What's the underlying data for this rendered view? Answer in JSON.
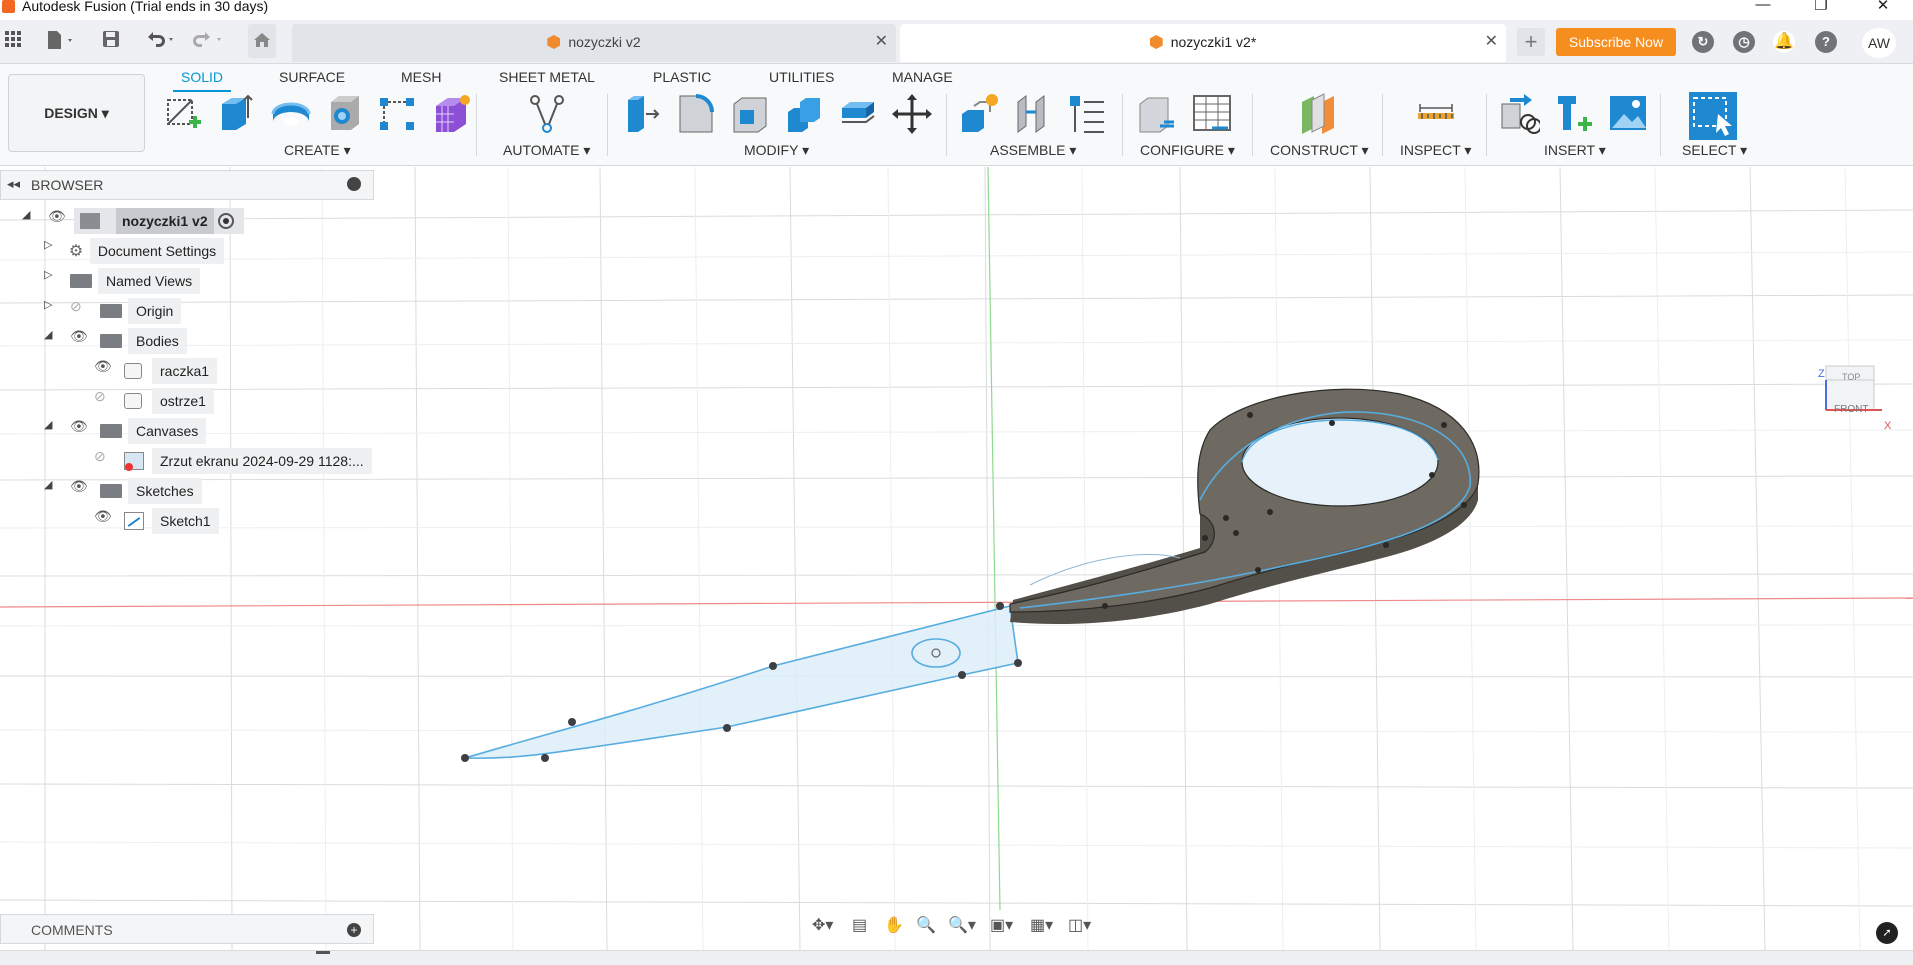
{
  "window": {
    "title": "Autodesk Fusion (Trial ends in 30 days)",
    "minimize": "—",
    "maximize": "❐",
    "close": "✕"
  },
  "quickbar": {
    "apps_icon": "grid-icon",
    "file_icon": "file-icon",
    "save_icon": "save-icon",
    "undo_icon": "undo-icon",
    "redo_icon": "redo-icon",
    "home_icon": "home-icon"
  },
  "tabs": [
    {
      "label": "nozyczki v2",
      "active": false
    },
    {
      "label": "nozyczki1 v2*",
      "active": true
    }
  ],
  "new_tab": "+",
  "subscribe": "Subscribe Now",
  "user_initials": "AW",
  "ribbon": {
    "workspace": "DESIGN ▾",
    "tabs": [
      "SOLID",
      "SURFACE",
      "MESH",
      "SHEET METAL",
      "PLASTIC",
      "UTILITIES",
      "MANAGE"
    ],
    "active_tab": "SOLID",
    "groups": [
      "CREATE ▾",
      "AUTOMATE ▾",
      "MODIFY ▾",
      "ASSEMBLE ▾",
      "CONFIGURE ▾",
      "CONSTRUCT ▾",
      "INSPECT ▾",
      "INSERT ▾",
      "SELECT ▾"
    ]
  },
  "browser": {
    "title": "BROWSER",
    "root": "nozyczki1 v2",
    "items": [
      "Document Settings",
      "Named Views",
      "Origin",
      "Bodies",
      "raczka1",
      "ostrze1",
      "Canvases",
      "Zrzut ekranu 2024-09-29 1128:...",
      "Sketches",
      "Sketch1"
    ]
  },
  "comments": {
    "title": "COMMENTS"
  },
  "viewcube": {
    "top": "TOP",
    "front": "FRONT",
    "z": "Z",
    "x": "X"
  },
  "colors": {
    "accent": "#0696d7",
    "subscribe": "#f58d1f",
    "body": "#6e6a62",
    "sketch_fill": "#d9ecf7",
    "sketch_line": "#49a7d9",
    "x_axis": "#e86c6c",
    "y_axis": "#7ed37e"
  }
}
